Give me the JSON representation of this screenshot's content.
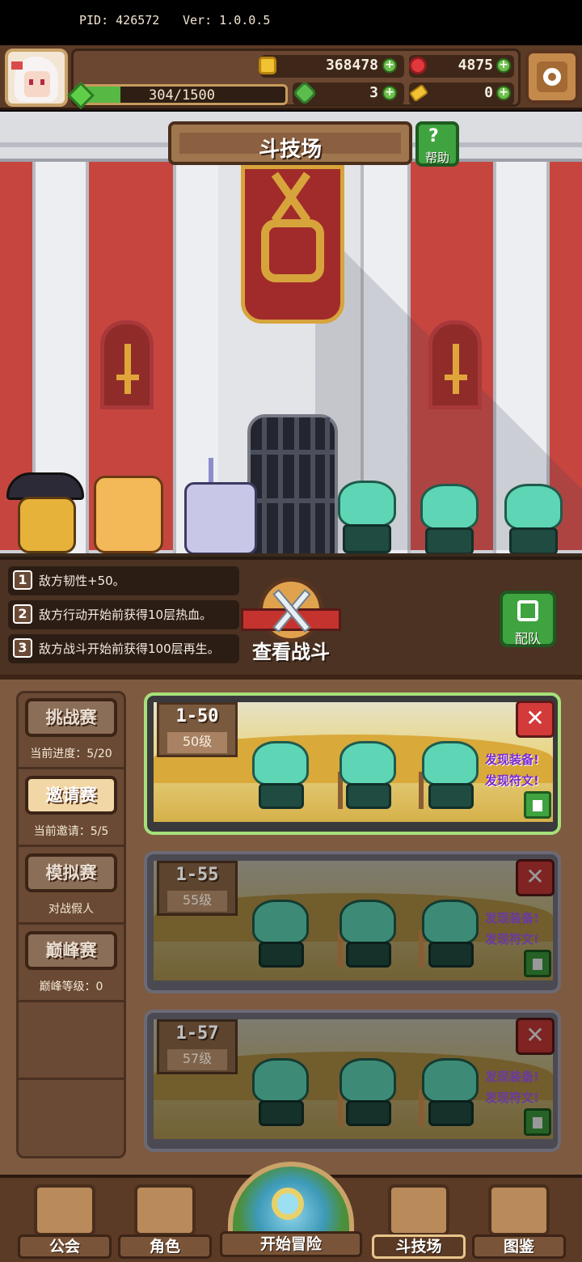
{
  "hud": {
    "pid": "PID: 426572",
    "version": "Ver: 1.0.0.5",
    "gold": "368478",
    "gems": "4875",
    "clover": "3",
    "keys": "0",
    "exp_text": "304/1500",
    "exp_progress": 0.203,
    "plus": "+"
  },
  "arena": {
    "title": "斗技场",
    "help_label": "帮助",
    "help_symbol": "?"
  },
  "effects": [
    {
      "num": "1",
      "text": "敌方韧性+50。"
    },
    {
      "num": "2",
      "text": "敌方行动开始前获得10层热血。"
    },
    {
      "num": "3",
      "text": "敌方战斗开始前获得100层再生。"
    }
  ],
  "battle": {
    "view_label": "查看战斗",
    "team_label": "配队"
  },
  "modes": [
    {
      "label": "挑战赛",
      "sub": "当前进度：5/20"
    },
    {
      "label": "邀请赛",
      "sub": "当前邀请：5/5"
    },
    {
      "label": "模拟赛",
      "sub": "对战假人"
    },
    {
      "label": "巅峰赛",
      "sub": "巅峰等级：0"
    }
  ],
  "opponents": [
    {
      "stage": "1-50",
      "level": "50级",
      "find1": "发现装备!",
      "find2": "发现符文!"
    },
    {
      "stage": "1-55",
      "level": "55级",
      "find1": "发现装备!",
      "find2": "发现符文!"
    },
    {
      "stage": "1-57",
      "level": "57级",
      "find1": "发现装备!",
      "find2": "发现符文!"
    }
  ],
  "close_symbol": "✕",
  "nav": {
    "guild": "公会",
    "character": "角色",
    "adventure": "开始冒险",
    "arena": "斗技场",
    "codex": "图鉴"
  },
  "colors": {
    "accent_green": "#3fa340",
    "panel_brown": "#7e5a40",
    "alert_red": "#d33a3a",
    "find_purple": "#7a2ad0"
  }
}
